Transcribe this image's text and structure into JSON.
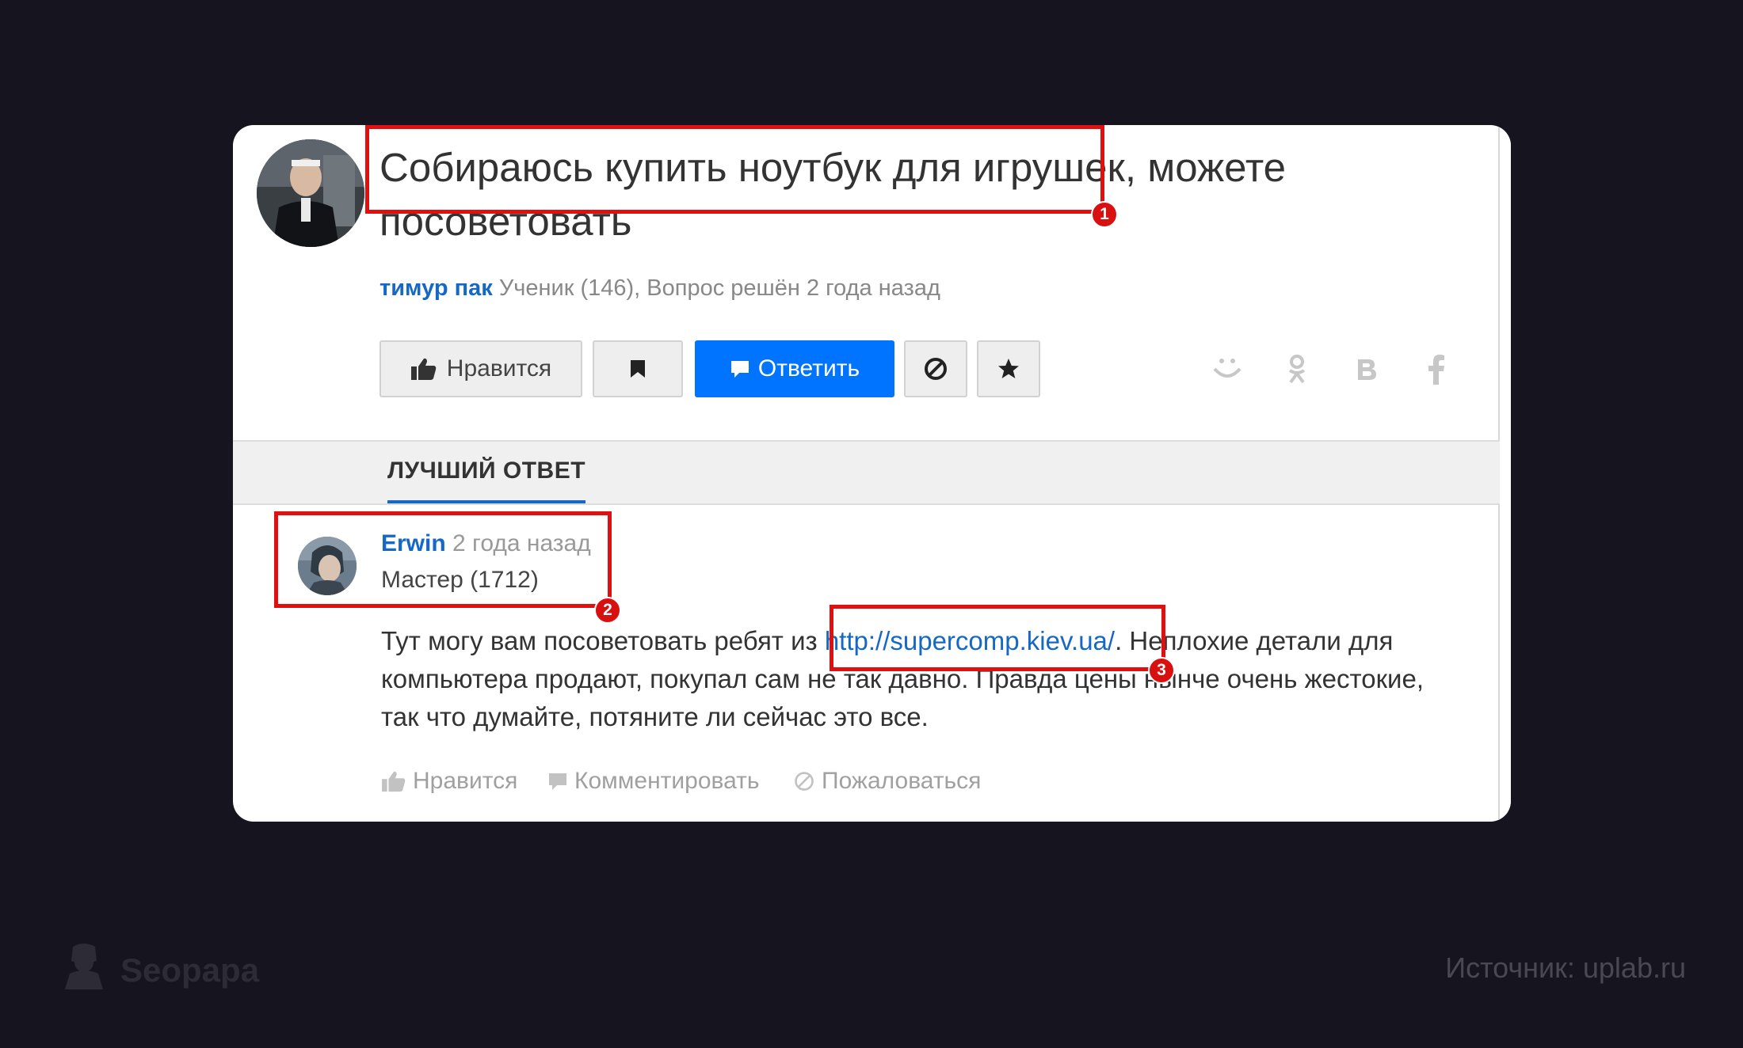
{
  "question": {
    "title": "Собираюсь купить ноутбук для игрушек, можете посоветовать",
    "author": "тимур пак",
    "meta_suffix": " Ученик (146), Вопрос решён 2 года назад"
  },
  "actions": {
    "like_label": "Нравится",
    "reply_label": "Ответить"
  },
  "share_icons": [
    "mail-smile-icon",
    "odnoklassniki-icon",
    "vk-icon",
    "facebook-icon"
  ],
  "best_answer": {
    "tab_label": "ЛУЧШИЙ ОТВЕТ",
    "author": "Erwin",
    "time": " 2 года назад",
    "rank": "Мастер (1712)",
    "text_before": "Тут могу вам посоветовать ребят из ",
    "link": "http://supercomp.kiev.ua/",
    "text_after": ". Неплохие детали для компьютера продают, покупал сам не так давно. Правда цены нынче очень жестокие, так что думайте, потяните ли сейчас это все.",
    "like_label": "Нравится",
    "comment_label": "Комментировать",
    "report_label": "Пожаловаться"
  },
  "annotations": [
    "1",
    "2",
    "3"
  ],
  "watermark": "Seopapa",
  "source": "Источник: uplab.ru",
  "colors": {
    "background": "#16141f",
    "link": "#1668c6",
    "primary_button": "#0073ff",
    "highlight": "#e01010"
  }
}
